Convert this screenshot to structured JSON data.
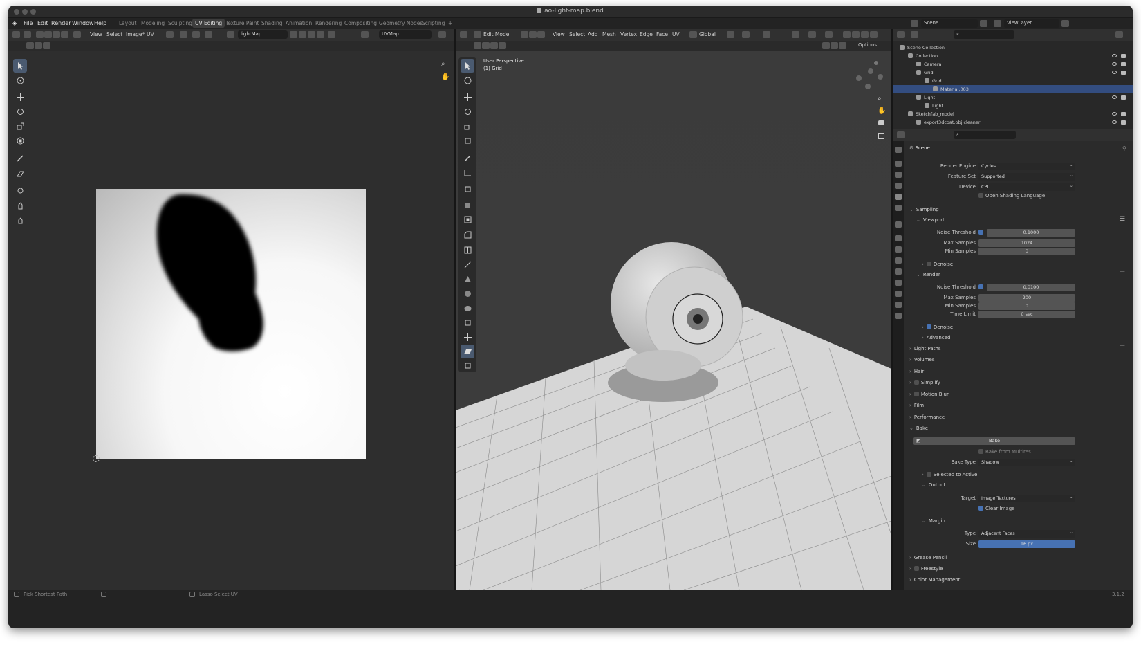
{
  "window": {
    "title": "ao-light-map.blend"
  },
  "menu": [
    "File",
    "Edit",
    "Render",
    "Window",
    "Help"
  ],
  "workspaces": [
    "Layout",
    "Modeling",
    "Sculpting",
    "UV Editing",
    "Texture Paint",
    "Shading",
    "Animation",
    "Rendering",
    "Compositing",
    "Geometry Nodes",
    "Scripting"
  ],
  "workspace_add": "+",
  "uv_editor": {
    "menus": [
      "View",
      "Select",
      "Image*",
      "UV"
    ],
    "image_name": "lightMap",
    "uvmap": "UVMap"
  },
  "viewport": {
    "mode": "Edit Mode",
    "menus": [
      "View",
      "Select",
      "Add",
      "Mesh",
      "Vertex",
      "Edge",
      "Face",
      "UV"
    ],
    "transform": "Global",
    "perspective": "User Perspective",
    "object_label": "(1) Grid",
    "options": "Options"
  },
  "topbar": {
    "scene": "Scene",
    "view_layer": "ViewLayer"
  },
  "outliner": {
    "rows": [
      {
        "label": "Scene Collection",
        "level": 0
      },
      {
        "label": "Collection",
        "level": 1
      },
      {
        "label": "Camera",
        "level": 2
      },
      {
        "label": "Grid",
        "level": 2
      },
      {
        "label": "Grid",
        "level": 3
      },
      {
        "label": "Material.003",
        "level": 4
      },
      {
        "label": "Light",
        "level": 2
      },
      {
        "label": "Light",
        "level": 3
      },
      {
        "label": "Sketchfab_model",
        "level": 1
      },
      {
        "label": "export3dcoat.obj.cleaner",
        "level": 2
      }
    ]
  },
  "properties": {
    "context": "Scene",
    "render_engine_label": "Render Engine",
    "render_engine": "Cycles",
    "feature_set_label": "Feature Set",
    "feature_set": "Supported",
    "device_label": "Device",
    "device": "CPU",
    "osl": "Open Shading Language",
    "sampling": "Sampling",
    "viewport": "Viewport",
    "vp_noise_label": "Noise Threshold",
    "vp_noise": "0.1000",
    "vp_max_label": "Max Samples",
    "vp_max": "1024",
    "vp_min_label": "Min Samples",
    "vp_min": "0",
    "vp_denoise": "Denoise",
    "render": "Render",
    "r_noise_label": "Noise Threshold",
    "r_noise": "0.0100",
    "r_max_label": "Max Samples",
    "r_max": "200",
    "r_min_label": "Min Samples",
    "r_min": "0",
    "r_time_label": "Time Limit",
    "r_time": "0 sec",
    "r_denoise": "Denoise",
    "advanced": "Advanced",
    "light_paths": "Light Paths",
    "volumes": "Volumes",
    "hair": "Hair",
    "simplify": "Simplify",
    "motion_blur": "Motion Blur",
    "film": "Film",
    "performance": "Performance",
    "bake": "Bake",
    "bake_button": "Bake",
    "bake_multires": "Bake from Multires",
    "bake_type_label": "Bake Type",
    "bake_type": "Shadow",
    "selected_to_active": "Selected to Active",
    "output": "Output",
    "target_label": "Target",
    "target": "Image Textures",
    "clear_image": "Clear Image",
    "margin": "Margin",
    "type_label": "Type",
    "type": "Adjacent Faces",
    "size_label": "Size",
    "size": "16 px",
    "grease_pencil": "Grease Pencil",
    "freestyle": "Freestyle",
    "color_management": "Color Management"
  },
  "status": {
    "left": "Pick Shortest Path",
    "mid": "Lasso Select UV",
    "version": "3.1.2"
  },
  "colors": {
    "accent": "#4772b3",
    "selected_row": "#334d80",
    "bg": "#1d1d1d",
    "header": "#303030"
  }
}
